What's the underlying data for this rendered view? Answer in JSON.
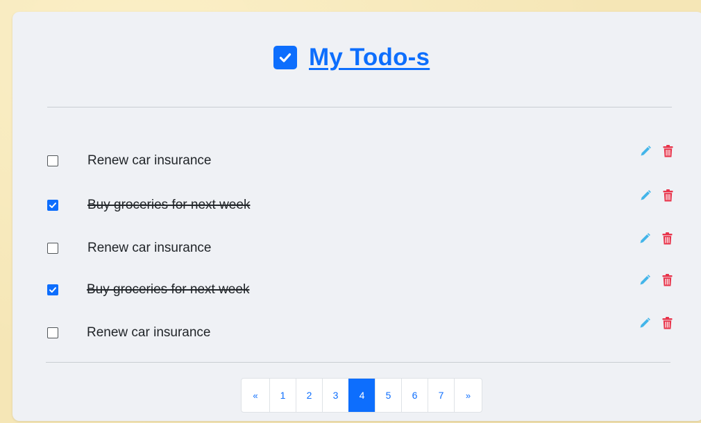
{
  "app": {
    "title": "My Todo-s"
  },
  "colors": {
    "accent": "#0d6efd",
    "edit_icon": "#43b5e9",
    "delete_icon": "#e8334a",
    "card_bg": "#eff1f5",
    "page_bg": "#f5e6b6"
  },
  "icons": {
    "title": "checkbox-checked-icon",
    "edit": "pencil-icon",
    "delete": "trash-icon"
  },
  "todos": [
    {
      "text": "Renew car insurance",
      "done": false
    },
    {
      "text": "Buy groceries for next week",
      "done": true
    },
    {
      "text": "Renew car insurance",
      "done": false
    },
    {
      "text": "Buy groceries for next week",
      "done": true
    },
    {
      "text": "Renew car insurance",
      "done": false
    }
  ],
  "pagination": {
    "prev_label": "«",
    "next_label": "»",
    "pages": [
      "1",
      "2",
      "3",
      "4",
      "5",
      "6",
      "7"
    ],
    "current_page": "4"
  }
}
